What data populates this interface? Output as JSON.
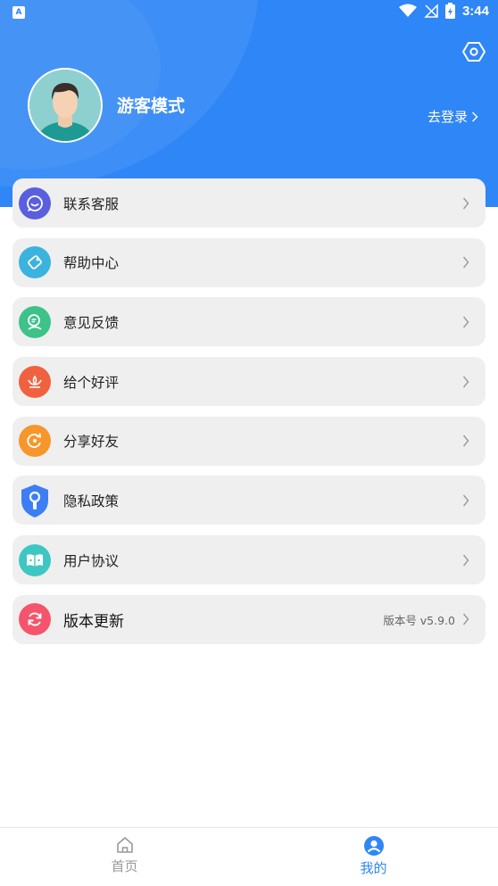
{
  "status_bar": {
    "time": "3:44",
    "left_icon": "A"
  },
  "profile": {
    "name": "游客模式",
    "login_link": "去登录",
    "avatar_icon": "user-avatar-icon"
  },
  "menu": {
    "items": [
      {
        "label": "联系客服",
        "icon": "chat-bubble-icon",
        "color": "#5a5fe0"
      },
      {
        "label": "帮助中心",
        "icon": "help-tag-icon",
        "color": "#3bb3de"
      },
      {
        "label": "意见反馈",
        "icon": "feedback-icon",
        "color": "#3dc28a"
      },
      {
        "label": "给个好评",
        "icon": "lotus-icon",
        "color": "#f0623f"
      },
      {
        "label": "分享好友",
        "icon": "share-refresh-icon",
        "color": "#f7962b"
      },
      {
        "label": "隐私政策",
        "icon": "shield-lock-icon",
        "color": "#3d7ef5"
      },
      {
        "label": "用户协议",
        "icon": "agreement-book-icon",
        "color": "#3ec7c2"
      },
      {
        "label": "版本更新",
        "icon": "sync-icon",
        "color": "#f4556c",
        "value": "版本号 v5.9.0"
      }
    ]
  },
  "tabbar": {
    "tabs": [
      {
        "label": "首页",
        "icon": "home-icon",
        "active": false
      },
      {
        "label": "我的",
        "icon": "profile-icon",
        "active": true
      }
    ]
  },
  "colors": {
    "primary": "#2f86f6",
    "card_bg": "#efefef"
  }
}
